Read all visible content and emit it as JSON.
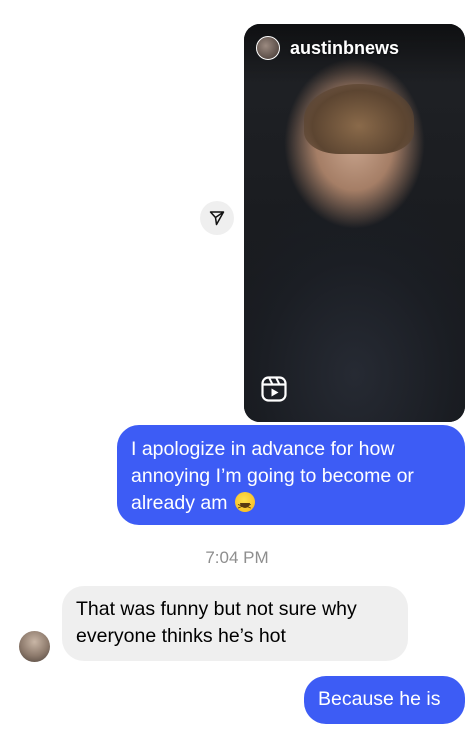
{
  "shared_reel": {
    "username": "austinbnews",
    "avatar_icon": "profile-avatar",
    "type_icon": "reels-icon"
  },
  "share_button": {
    "icon": "send-arrow-icon"
  },
  "messages": [
    {
      "direction": "outgoing",
      "text": "I apologize in advance for how annoying I’m going to become or already am",
      "emoji": "grinning-squinting-face"
    },
    {
      "direction": "incoming",
      "text": "That was funny but not sure why everyone thinks he’s hot"
    },
    {
      "direction": "outgoing",
      "text": "Because he is"
    }
  ],
  "timestamp": "7:04 PM",
  "colors": {
    "sent_bubble": "#3d5cf5",
    "received_bubble": "#efefef",
    "timestamp_text": "#8e8e8e"
  }
}
